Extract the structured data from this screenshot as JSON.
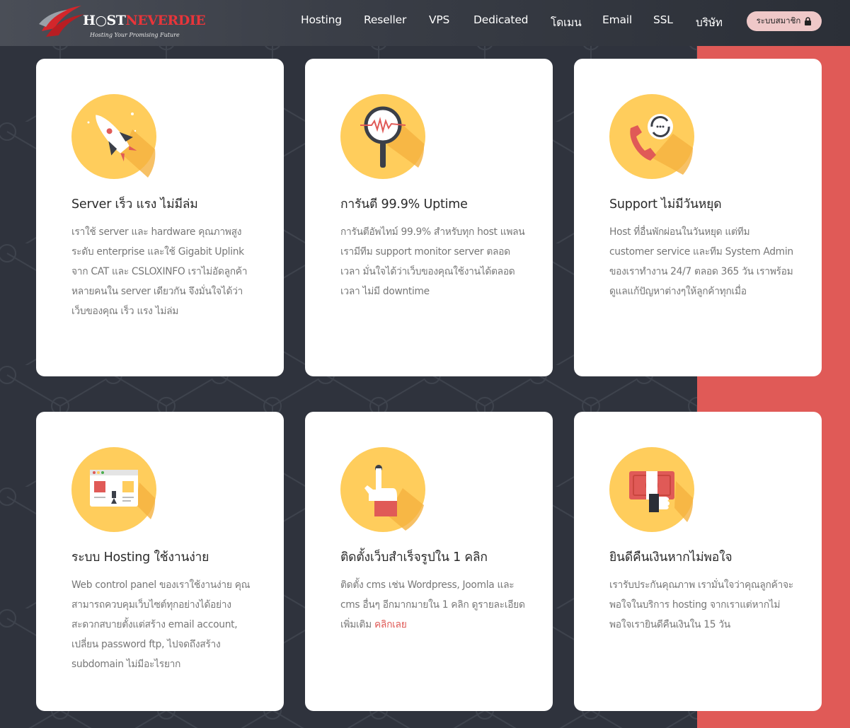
{
  "header": {
    "logo_main_a": "H",
    "logo_main_b": "ST",
    "logo_main_red": "NEVERDIE",
    "logo_tagline": "Hosting Your Promising Future",
    "nav": [
      "Hosting",
      "Reseller",
      "VPS",
      "Dedicated",
      "โดเมน",
      "Email",
      "SSL",
      "บริษัท"
    ],
    "member_label": "ระบบสมาชิก"
  },
  "colors": {
    "accent_red": "#e05a57",
    "dark_bg": "#2f333d",
    "icon_yellow": "#ffcd5c"
  },
  "features": [
    {
      "icon": "rocket-icon",
      "title": "Server เร็ว แรง ไม่มีล่ม",
      "text": "เราใช้ server และ hardware คุณภาพสูงระดับ enterprise และใช้ Gigabit Uplink จาก CAT และ CSLOXINFO เราไม่อัดลูกค้าหลายคนใน server เดียวกัน จึงมั่นใจได้ว่า เว็บของคุณ เร็ว แรง ไม่ล่ม"
    },
    {
      "icon": "magnifier-icon",
      "title": "การันตี 99.9% Uptime",
      "text": "การันตีอัพไทม์ 99.9% สำหรับทุก host แพลน เรามีทีม support monitor server ตลอดเวลา มั่นใจได้ว่าเว็บของคุณใช้งานได้ตลอดเวลา ไม่มี downtime"
    },
    {
      "icon": "phone-support-icon",
      "title": "Support ไม่มีวันหยุด",
      "text": "Host ที่อื่นพักผ่อนในวันหยุด แต่ทีม customer service และทีม System Admin ของเราทำงาน 24/7 ตลอด 365 วัน เราพร้อมดูแลแก้ปัญหาต่างๆให้ลูกค้าทุกเมื่อ"
    },
    {
      "icon": "control-panel-icon",
      "title": "ระบบ Hosting ใช้งานง่าย",
      "text": "Web control panel ของเราใช้งานง่าย คุณสามารถควบคุมเว็บไซต์ทุกอย่างได้อย่างสะดวกสบายตั้งแต่สร้าง email account, เปลี่ยน password ftp, ไปจดถึงสร้าง subdomain ไม่มีอะไรยาก"
    },
    {
      "icon": "click-hand-icon",
      "title": "ติดตั้งเว็บสำเร็จรูปใน 1 คลิก",
      "text": "ติดตั้ง cms เช่น Wordpress, Joomla และ cms อื่นๆ อีกมากมายใน 1 คลิก ดูรายละเอียดเพิ่มเติม",
      "link": "คลิกเลย"
    },
    {
      "icon": "money-back-icon",
      "title": "ยินดีคืนเงินหากไม่พอใจ",
      "text": "เรารับประกันคุณภาพ เรามั่นใจว่าคุณลูกค้าจะพอใจในบริการ hosting จากเราแต่หากไม่พอใจเรายินดีคืนเงินใน 15 วัน"
    }
  ]
}
